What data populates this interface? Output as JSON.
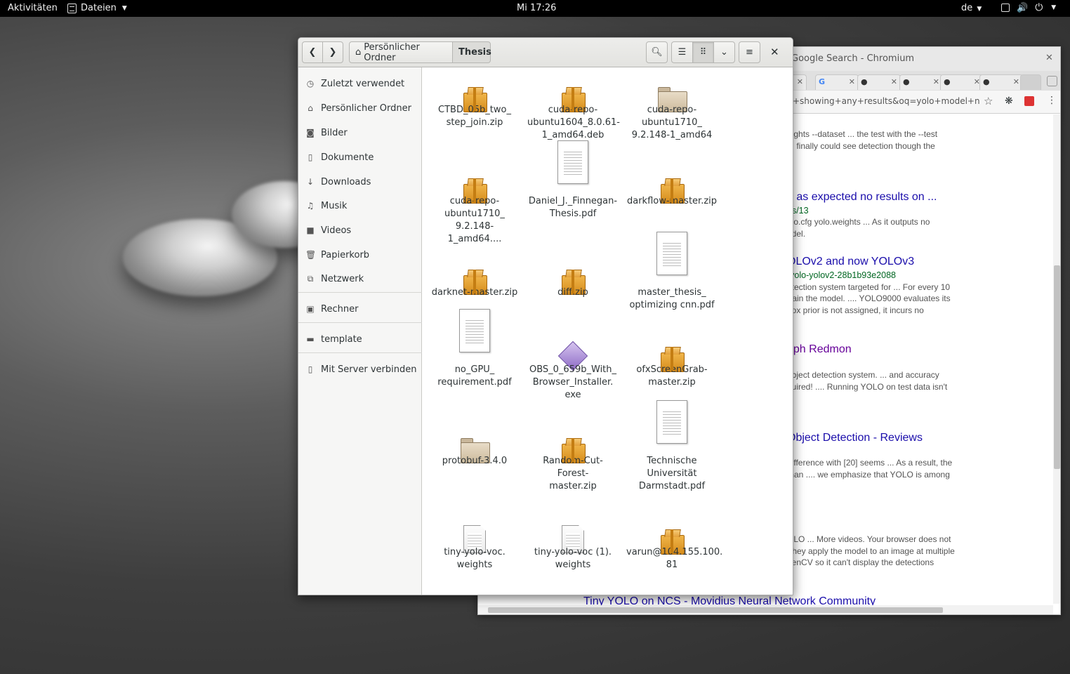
{
  "topbar": {
    "activities": "Aktivitäten",
    "app_menu": "Dateien",
    "clock": "Mi 17:26",
    "language": "de"
  },
  "chromium": {
    "title": "Google Search - Chromium",
    "omnibox": "+showing+any+results&oq=yolo+model+n...",
    "tabs": [
      "",
      "",
      "",
      "",
      ""
    ],
    "results": {
      "r1_snip1": "eights --dataset ... the test with the --test",
      "r1_snip2": ". I finally could see detection though the",
      "r2_title": "n as expected no results on ...",
      "r2_url": "es/13",
      "r2_snip1": "olo.cfg yolo.weights ... As it outputs no",
      "r2_snip2": "odel.",
      "r3_title": "OLOv2 and now YOLOv3",
      "r3_url": "-yolo-yolov2-28b1b93e2088",
      "r3_snip1": "etection system targeted for ... For every 10",
      "r3_snip2": "train the model. .... YOLO9000 evaluates its",
      "r3_snip3": "box prior is not assigned, it incurs no",
      "r4_title": "eph Redmon",
      "r4_snip1": "object detection system. ... and accuracy",
      "r4_snip2": "quired! .... Running YOLO on test data isn't",
      "r5_title": "Object Detection - Reviews",
      "r5_snip1": "difference with [20] seems ... As a result, the",
      "r5_snip2": "than .... we emphasize that YOLO is among",
      "r6_snip1": "OLO ... More videos. Your browser does not",
      "r6_snip2": "They apply the model to an image at multiple",
      "r6_snip3": "penCV so it can't display the detections",
      "bottom_link": "Tiny YOLO on NCS - Movidius Neural Network Community"
    }
  },
  "nautilus": {
    "breadcrumb_home": "Persönlicher Ordner",
    "breadcrumb_current": "Thesis",
    "sidebar": {
      "recent": "Zuletzt verwendet",
      "home": "Persönlicher Ordner",
      "pictures": "Bilder",
      "documents": "Dokumente",
      "downloads": "Downloads",
      "music": "Musik",
      "videos": "Videos",
      "trash": "Papierkorb",
      "network": "Netzwerk",
      "computer": "Rechner",
      "template": "template",
      "connect": "Mit Server verbinden"
    },
    "files": [
      {
        "label": "CTBD_05b_two_\nstep_join.zip",
        "kind": "archive"
      },
      {
        "label": "cuda-repo-\nubuntu1604_8.0.61-\n1_amd64.deb",
        "kind": "archive"
      },
      {
        "label": "cuda-repo-\nubuntu1710_\n9.2.148-1_amd64",
        "kind": "folder"
      },
      {
        "label": "cuda-repo-\nubuntu1710_\n9.2.148-1_amd64....",
        "kind": "archive"
      },
      {
        "label": "Daniel_J._Finnegan-\nThesis.pdf",
        "kind": "pdf"
      },
      {
        "label": "darkflow-master.zip",
        "kind": "archive"
      },
      {
        "label": "darknet-master.zip",
        "kind": "archive"
      },
      {
        "label": "diff.zip",
        "kind": "archive"
      },
      {
        "label": "master_thesis_\noptimizing cnn.pdf",
        "kind": "pdf"
      },
      {
        "label": "no_GPU_\nrequirement.pdf",
        "kind": "pdf"
      },
      {
        "label": "OBS_0_659b_With_\nBrowser_Installer.\nexe",
        "kind": "exe"
      },
      {
        "label": "ofxScreenGrab-\nmaster.zip",
        "kind": "archive"
      },
      {
        "label": "protobuf-3.4.0",
        "kind": "folder"
      },
      {
        "label": "Random-Cut-Forest-\nmaster.zip",
        "kind": "archive"
      },
      {
        "label": "Technische\nUniversität\nDarmstadt.pdf",
        "kind": "pdf"
      },
      {
        "label": "tiny-yolo-voc.\nweights",
        "kind": "text"
      },
      {
        "label": "tiny-yolo-voc (1).\nweights",
        "kind": "text"
      },
      {
        "label": "varun@104.155.100.\n81",
        "kind": "archive"
      },
      {
        "label": "",
        "kind": "folder"
      },
      {
        "label": "",
        "kind": "text"
      },
      {
        "label": "",
        "kind": "text"
      }
    ]
  }
}
